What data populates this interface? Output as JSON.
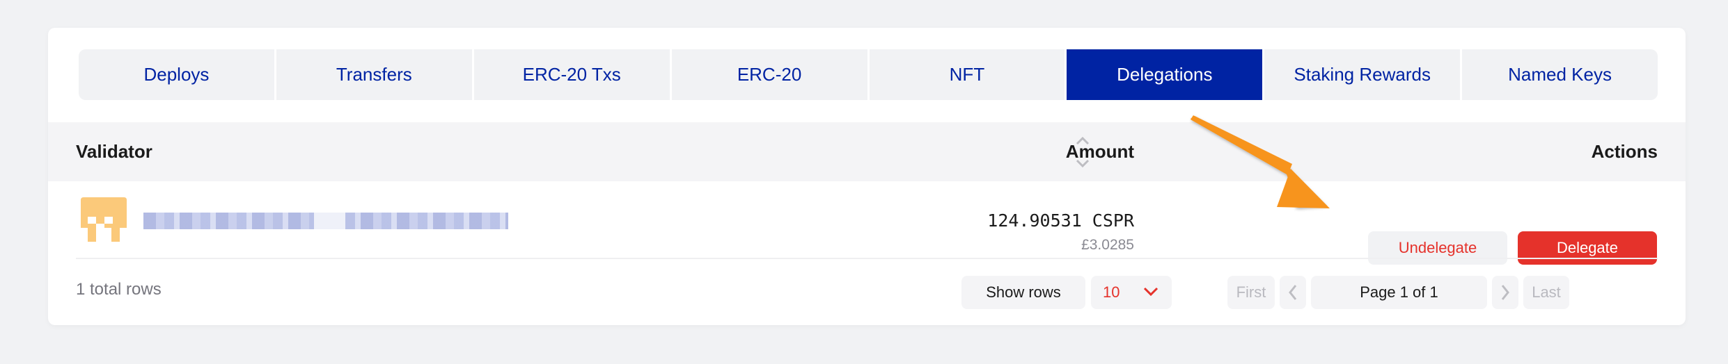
{
  "tabs": [
    {
      "label": "Deploys",
      "active": false
    },
    {
      "label": "Transfers",
      "active": false
    },
    {
      "label": "ERC-20 Txs",
      "active": false
    },
    {
      "label": "ERC-20",
      "active": false
    },
    {
      "label": "NFT",
      "active": false
    },
    {
      "label": "Delegations",
      "active": true
    },
    {
      "label": "Staking Rewards",
      "active": false
    },
    {
      "label": "Named Keys",
      "active": false
    }
  ],
  "table": {
    "headers": {
      "validator": "Validator",
      "amount": "Amount",
      "actions": "Actions"
    },
    "rows": [
      {
        "validator_avatar": "pixel-avatar-icon",
        "validator_hash": "[redacted]",
        "amount": "124.90531 CSPR",
        "amount_fiat": "£3.0285",
        "actions": {
          "undelegate": "Undelegate",
          "delegate": "Delegate"
        }
      }
    ]
  },
  "footer": {
    "total_rows": "1 total rows",
    "show_rows_label": "Show rows",
    "rows_per_page": "10",
    "pagination": {
      "first": "First",
      "page_label": "Page 1 of 1",
      "last": "Last"
    }
  },
  "colors": {
    "brand_blue": "#0023a3",
    "danger_red": "#e5322b",
    "annotation_orange": "#f7941d",
    "avatar_orange": "#fbc97a"
  }
}
